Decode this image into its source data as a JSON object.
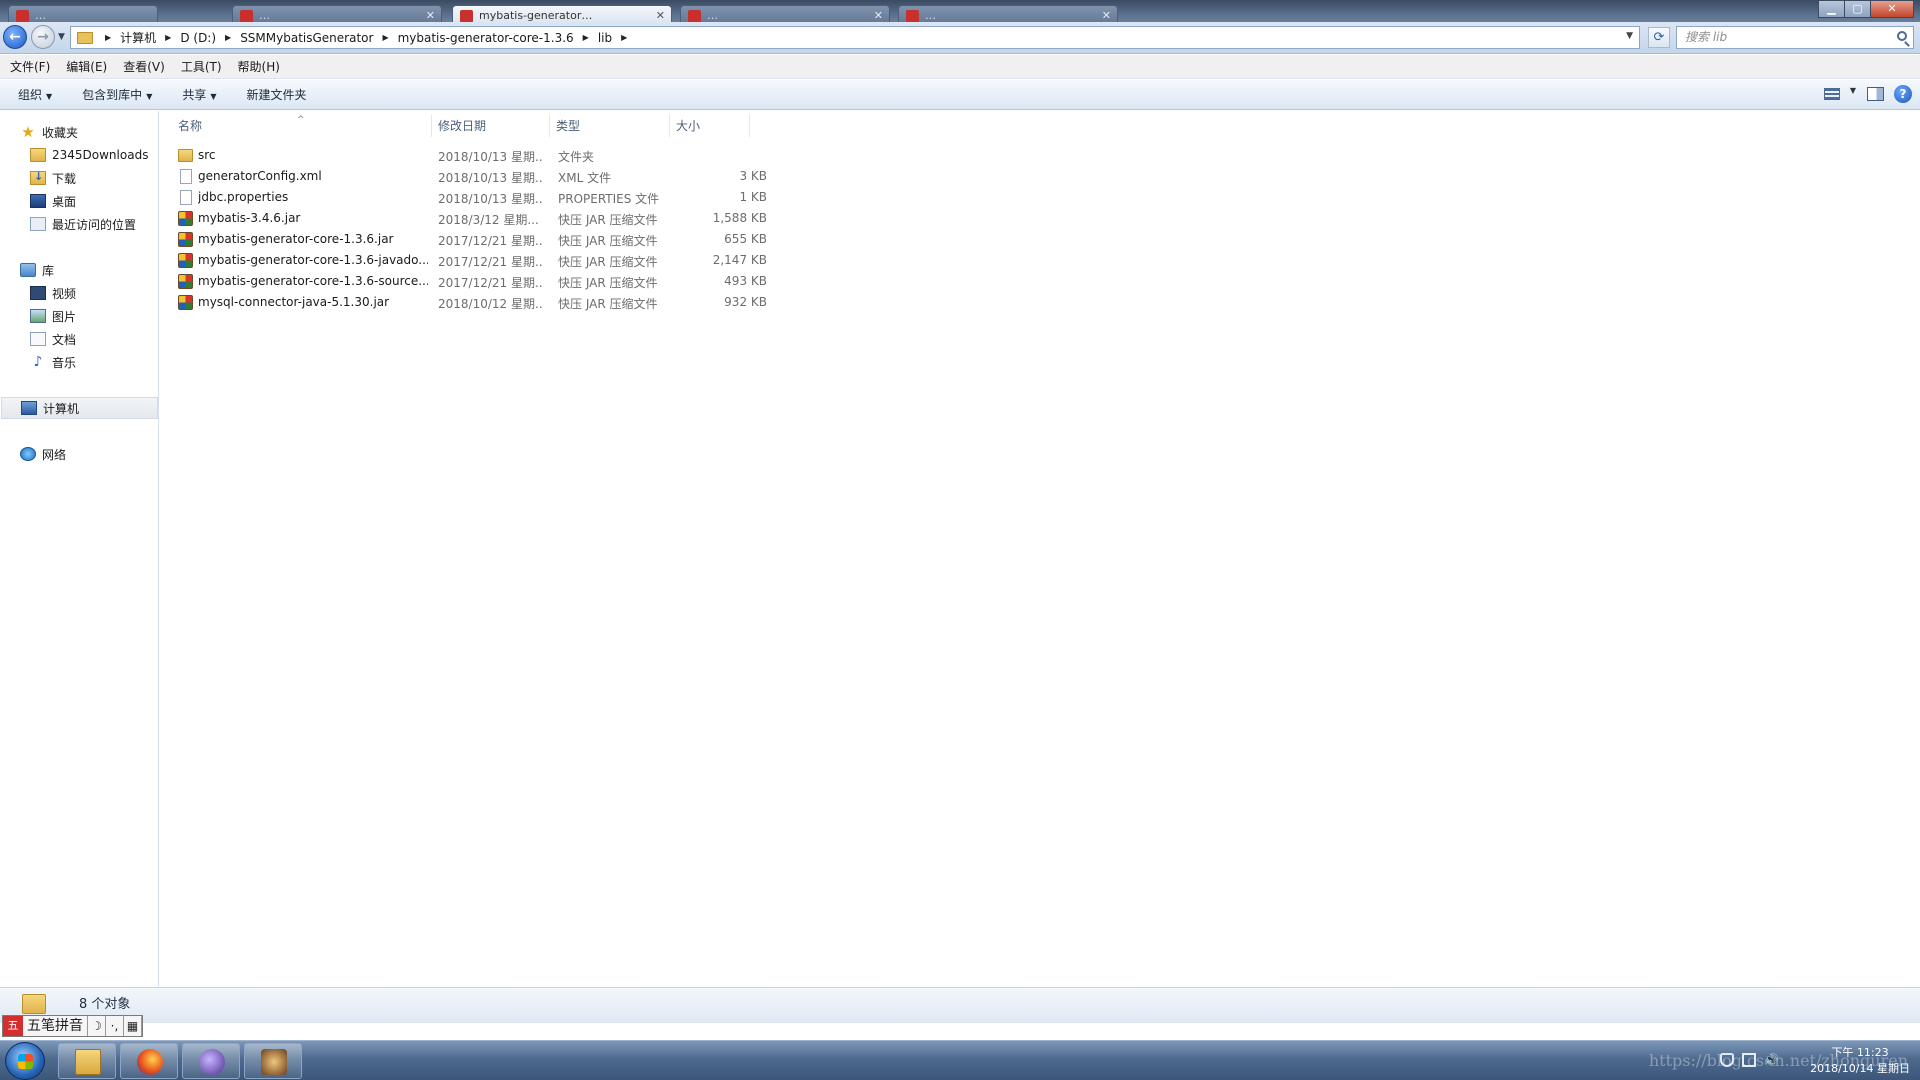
{
  "window": {
    "tabs": [
      {
        "label": "…"
      },
      {
        "label": "…"
      },
      {
        "label": "mybatis-generator…"
      },
      {
        "label": "…"
      },
      {
        "label": "…"
      }
    ],
    "buttons": {
      "minimize": "▁",
      "maximize": "▢",
      "close": "✕"
    }
  },
  "address": {
    "crumbs": [
      "计算机",
      "D (D:)",
      "SSMMybatisGenerator",
      "mybatis-generator-core-1.3.6",
      "lib"
    ],
    "search_placeholder": "搜索 lib"
  },
  "menu": [
    "文件(F)",
    "编辑(E)",
    "查看(V)",
    "工具(T)",
    "帮助(H)"
  ],
  "commands": {
    "organize": "组织",
    "include_library": "包含到库中",
    "share": "共享",
    "new_folder": "新建文件夹"
  },
  "nav": {
    "favorites": "收藏夹",
    "fav_items": [
      "2345Downloads",
      "下载",
      "桌面",
      "最近访问的位置"
    ],
    "libraries": "库",
    "lib_items": [
      "视频",
      "图片",
      "文档",
      "音乐"
    ],
    "computer": "计算机",
    "network": "网络"
  },
  "columns": {
    "name": "名称",
    "date": "修改日期",
    "type": "类型",
    "size": "大小"
  },
  "files": [
    {
      "icon": "folder-icon",
      "name": "src",
      "date": "2018/10/13 星期...",
      "type": "文件夹",
      "size": ""
    },
    {
      "icon": "xml-file-icon",
      "name": "generatorConfig.xml",
      "date": "2018/10/13 星期...",
      "type": "XML 文件",
      "size": "3 KB"
    },
    {
      "icon": "properties-file-icon",
      "name": "jdbc.properties",
      "date": "2018/10/13 星期...",
      "type": "PROPERTIES 文件",
      "size": "1 KB"
    },
    {
      "icon": "jar-file-icon",
      "name": "mybatis-3.4.6.jar",
      "date": "2018/3/12 星期...",
      "type": "快压 JAR 压缩文件",
      "size": "1,588 KB"
    },
    {
      "icon": "jar-file-icon",
      "name": "mybatis-generator-core-1.3.6.jar",
      "date": "2017/12/21 星期...",
      "type": "快压 JAR 压缩文件",
      "size": "655 KB"
    },
    {
      "icon": "jar-file-icon",
      "name": "mybatis-generator-core-1.3.6-javado...",
      "date": "2017/12/21 星期...",
      "type": "快压 JAR 压缩文件",
      "size": "2,147 KB"
    },
    {
      "icon": "jar-file-icon",
      "name": "mybatis-generator-core-1.3.6-source...",
      "date": "2017/12/21 星期...",
      "type": "快压 JAR 压缩文件",
      "size": "493 KB"
    },
    {
      "icon": "jar-file-icon",
      "name": "mysql-connector-java-5.1.30.jar",
      "date": "2018/10/12 星期...",
      "type": "快压 JAR 压缩文件",
      "size": "932 KB"
    }
  ],
  "status": {
    "count": "8 个对象"
  },
  "ime": {
    "label": "五笔拼音",
    "moon": "☽",
    "dots": "·,",
    "kbd": "▦"
  },
  "taskbar": {
    "apps": [
      "windows-explorer",
      "firefox",
      "eclipse",
      "java-ee"
    ],
    "clock_time": "下午 11:23",
    "clock_date": "2018/10/14 星期日",
    "watermark": "https://blog.csdn.net/zhonguren"
  },
  "colors": {
    "selection": "#e4e8ee",
    "taskbar": "#4e6b8f",
    "accent": "#1c58c4"
  }
}
